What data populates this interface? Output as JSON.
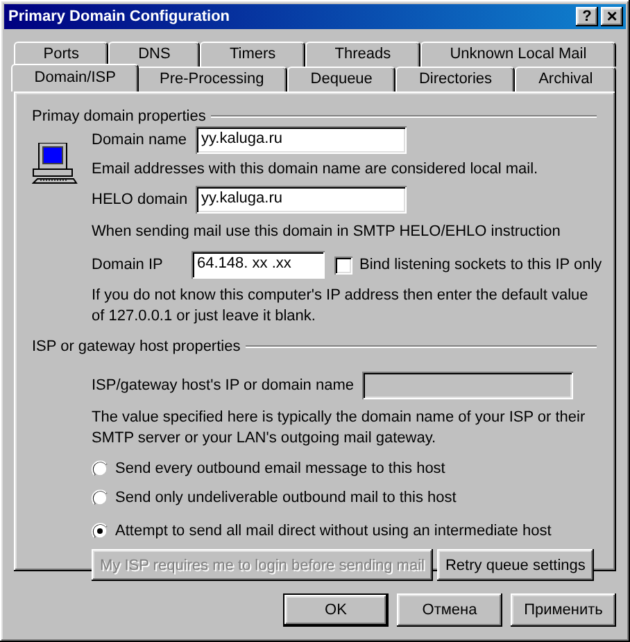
{
  "window": {
    "title": "Primary Domain Configuration",
    "title_buttons": [
      {
        "kind": "help",
        "label": "?"
      },
      {
        "kind": "close",
        "label": "×"
      }
    ]
  },
  "tab_rows": [
    {
      "tabs": [
        {
          "label": "Ports",
          "selected": false
        },
        {
          "label": "DNS",
          "selected": false
        },
        {
          "label": "Timers",
          "selected": false
        },
        {
          "label": "Threads",
          "selected": false
        },
        {
          "label": "Unknown Local Mail",
          "selected": false
        }
      ]
    },
    {
      "tabs": [
        {
          "label": "Domain/ISP",
          "selected": true
        },
        {
          "label": "Pre-Processing",
          "selected": false
        },
        {
          "label": "Dequeue",
          "selected": false
        },
        {
          "label": "Directories",
          "selected": false
        },
        {
          "label": "Archival",
          "selected": false
        }
      ]
    }
  ],
  "primary": {
    "heading": "Primay domain properties",
    "domain_name": {
      "label": "Domain name",
      "value": "yy.kaluga.ru"
    },
    "domain_note": "Email addresses with this domain name are considered local mail.",
    "helo_domain": {
      "label": "HELO domain",
      "value": "yy.kaluga.ru"
    },
    "helo_note": "When sending mail use this domain in SMTP HELO/EHLO instruction",
    "domain_ip": {
      "label": "Domain IP",
      "value": "64.148. xx .xx"
    },
    "bind_checkbox": {
      "label": "Bind listening sockets to this IP only",
      "checked": false
    },
    "ip_note": [
      "If you do not know this computer's IP address then enter the default value",
      "of 127.0.0.1 or just leave it blank."
    ]
  },
  "isp": {
    "heading": "ISP or gateway host properties",
    "host_field": {
      "label": "ISP/gateway host's IP or domain name",
      "disabled": true
    },
    "note": [
      "The value specified here is typically the domain name of your ISP or their",
      "SMTP server or your LAN's outgoing mail gateway."
    ],
    "options": [
      {
        "label": "Send every outbound email message to this host",
        "selected": false
      },
      {
        "label": "Send only undeliverable outbound mail to this host",
        "selected": false
      },
      {
        "label": "Attempt to send all mail direct without using an intermediate host",
        "selected": true
      }
    ],
    "buttons": [
      {
        "label": "My ISP requires me to login before sending mail",
        "disabled": true
      },
      {
        "label": "Retry queue settings",
        "disabled": false
      }
    ]
  },
  "footer_buttons": [
    {
      "label": "OK",
      "default": true
    },
    {
      "label": "Отмена",
      "default": false
    },
    {
      "label": "Применить",
      "default": false
    }
  ]
}
